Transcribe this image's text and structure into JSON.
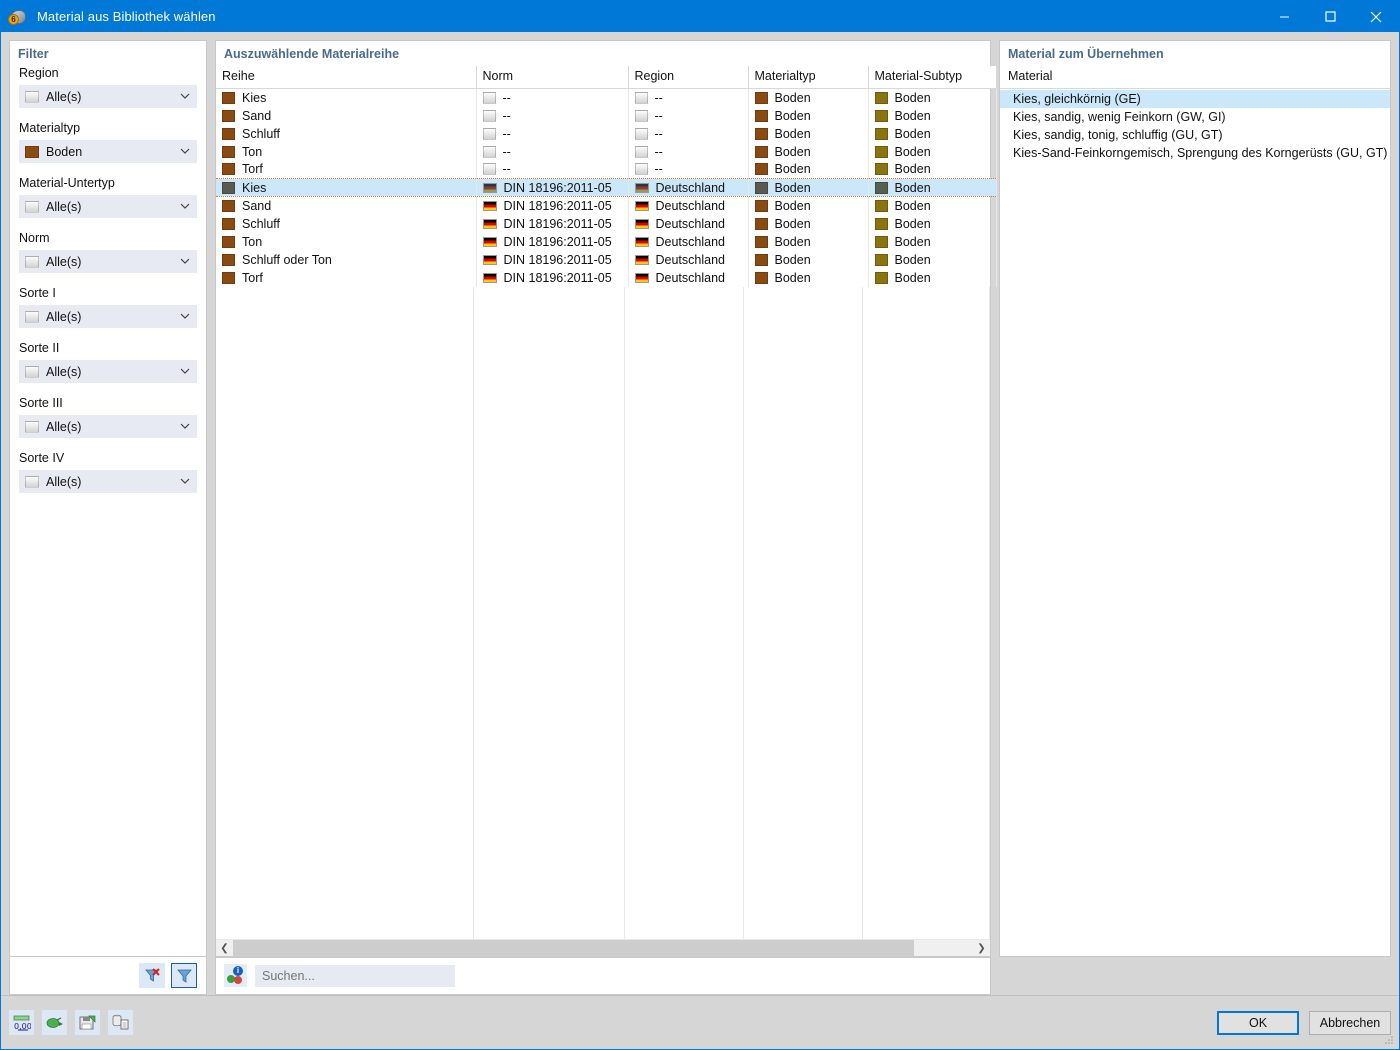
{
  "window": {
    "title": "Material aus Bibliothek wählen",
    "icon": "material-library-icon",
    "controls": {
      "minimize": "minimize-icon",
      "maximize": "maximize-icon",
      "close": "close-icon"
    },
    "accent": "#0078d7"
  },
  "filter": {
    "title": "Filter",
    "groups": [
      {
        "label": "Region",
        "value": "Alle(s)",
        "swatch": "grey"
      },
      {
        "label": "Materialtyp",
        "value": "Boden",
        "swatch": "brown"
      },
      {
        "label": "Material-Untertyp",
        "value": "Alle(s)",
        "swatch": "grey"
      },
      {
        "label": "Norm",
        "value": "Alle(s)",
        "swatch": "grey"
      },
      {
        "label": "Sorte I",
        "value": "Alle(s)",
        "swatch": "grey"
      },
      {
        "label": "Sorte II",
        "value": "Alle(s)",
        "swatch": "grey"
      },
      {
        "label": "Sorte III",
        "value": "Alle(s)",
        "swatch": "grey"
      },
      {
        "label": "Sorte IV",
        "value": "Alle(s)",
        "swatch": "grey"
      }
    ],
    "buttons": [
      {
        "name": "clear-filter-button",
        "icon": "filter-clear-icon",
        "active": false
      },
      {
        "name": "apply-filter-button",
        "icon": "filter-icon",
        "active": true
      }
    ]
  },
  "table": {
    "title": "Auszuwählende Materialreihe",
    "columns": [
      "Reihe",
      "Norm",
      "Region",
      "Materialtyp",
      "Material-Subtyp"
    ],
    "rows": [
      {
        "reihe": "Kies",
        "norm": "--",
        "region": "--",
        "materialtyp": "Boden",
        "subtyp": "Boden",
        "selected": false
      },
      {
        "reihe": "Sand",
        "norm": "--",
        "region": "--",
        "materialtyp": "Boden",
        "subtyp": "Boden",
        "selected": false
      },
      {
        "reihe": "Schluff",
        "norm": "--",
        "region": "--",
        "materialtyp": "Boden",
        "subtyp": "Boden",
        "selected": false
      },
      {
        "reihe": "Ton",
        "norm": "--",
        "region": "--",
        "materialtyp": "Boden",
        "subtyp": "Boden",
        "selected": false
      },
      {
        "reihe": "Torf",
        "norm": "--",
        "region": "--",
        "materialtyp": "Boden",
        "subtyp": "Boden",
        "selected": false
      },
      {
        "reihe": "Kies",
        "norm": "DIN 18196:2011-05",
        "region": "Deutschland",
        "materialtyp": "Boden",
        "subtyp": "Boden",
        "selected": true
      },
      {
        "reihe": "Sand",
        "norm": "DIN 18196:2011-05",
        "region": "Deutschland",
        "materialtyp": "Boden",
        "subtyp": "Boden",
        "selected": false
      },
      {
        "reihe": "Schluff",
        "norm": "DIN 18196:2011-05",
        "region": "Deutschland",
        "materialtyp": "Boden",
        "subtyp": "Boden",
        "selected": false
      },
      {
        "reihe": "Ton",
        "norm": "DIN 18196:2011-05",
        "region": "Deutschland",
        "materialtyp": "Boden",
        "subtyp": "Boden",
        "selected": false
      },
      {
        "reihe": "Schluff oder Ton",
        "norm": "DIN 18196:2011-05",
        "region": "Deutschland",
        "materialtyp": "Boden",
        "subtyp": "Boden",
        "selected": false
      },
      {
        "reihe": "Torf",
        "norm": "DIN 18196:2011-05",
        "region": "Deutschland",
        "materialtyp": "Boden",
        "subtyp": "Boden",
        "selected": false
      }
    ],
    "scrollbar": {
      "left_arrow": "chevron-left-icon",
      "right_arrow": "chevron-right-icon"
    }
  },
  "search": {
    "icon": "search-materials-icon",
    "placeholder": "Suchen...",
    "value": ""
  },
  "right": {
    "title": "Material zum Übernehmen",
    "column": "Material",
    "items": [
      {
        "label": "Kies, gleichkörnig (GE)",
        "selected": true
      },
      {
        "label": "Kies, sandig, wenig Feinkorn (GW, GI)",
        "selected": false
      },
      {
        "label": "Kies, sandig, tonig, schluffig (GU, GT)",
        "selected": false
      },
      {
        "label": "Kies-Sand-Feinkorngemisch, Sprengung des Korngerüsts (GU, GT)",
        "selected": false
      }
    ]
  },
  "toolbar": {
    "buttons": [
      {
        "name": "number-format-button",
        "icon": "number-format-icon"
      },
      {
        "name": "export-button",
        "icon": "export-plug-icon"
      },
      {
        "name": "save-button",
        "icon": "save-disk-icon"
      },
      {
        "name": "database-button",
        "icon": "database-document-icon"
      }
    ]
  },
  "footer": {
    "ok_label": "OK",
    "cancel_label": "Abbrechen"
  }
}
